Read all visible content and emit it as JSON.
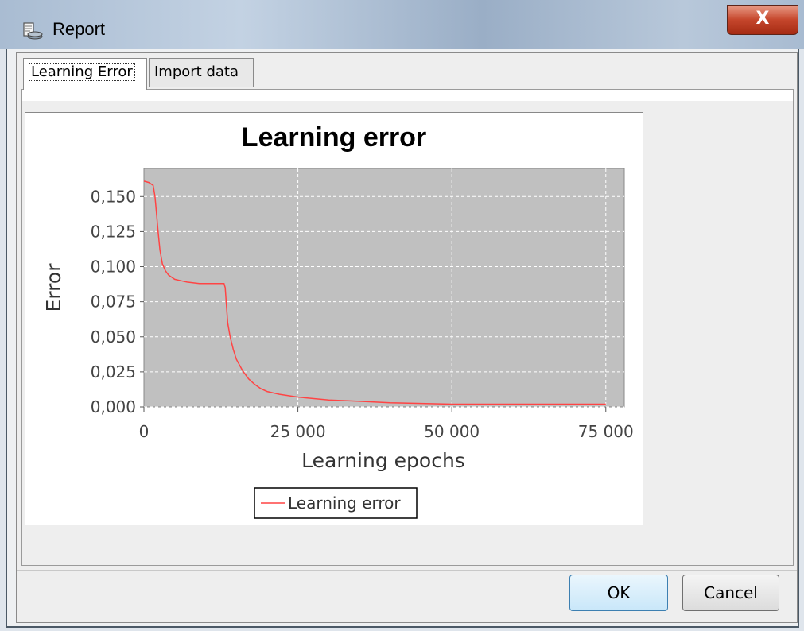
{
  "window": {
    "title": "Report",
    "close_glyph": "X",
    "app_icon": "report-icon"
  },
  "tabs": [
    {
      "label": "Learning Error",
      "active": true
    },
    {
      "label": "Import data",
      "active": false
    }
  ],
  "chart_data": {
    "type": "line",
    "title": "Learning error",
    "xlabel": "Learning epochs",
    "ylabel": "Error",
    "xlim": [
      0,
      78000
    ],
    "ylim": [
      0,
      0.17
    ],
    "x_ticks": [
      "0",
      "25 000",
      "50 000",
      "75 000"
    ],
    "y_ticks": [
      "0,000",
      "0,025",
      "0,050",
      "0,075",
      "0,100",
      "0,125",
      "0,150"
    ],
    "grid": true,
    "legend_position": "bottom",
    "series": [
      {
        "name": "Learning error",
        "color": "#ff4444",
        "x": [
          0,
          800,
          1500,
          1800,
          2000,
          2300,
          2600,
          3000,
          3500,
          4000,
          5000,
          6000,
          7000,
          9000,
          12000,
          13000,
          13200,
          13400,
          13600,
          14000,
          14500,
          15000,
          16000,
          17000,
          18000,
          19000,
          20000,
          22000,
          25000,
          30000,
          35000,
          40000,
          50000,
          60000,
          70000,
          75000
        ],
        "y": [
          0.161,
          0.16,
          0.158,
          0.15,
          0.14,
          0.125,
          0.112,
          0.102,
          0.097,
          0.094,
          0.091,
          0.09,
          0.089,
          0.088,
          0.088,
          0.088,
          0.085,
          0.072,
          0.06,
          0.05,
          0.041,
          0.034,
          0.026,
          0.02,
          0.016,
          0.013,
          0.011,
          0.009,
          0.007,
          0.005,
          0.004,
          0.003,
          0.002,
          0.002,
          0.002,
          0.002
        ]
      }
    ]
  },
  "buttons": {
    "ok_label": "OK",
    "cancel_label": "Cancel"
  }
}
